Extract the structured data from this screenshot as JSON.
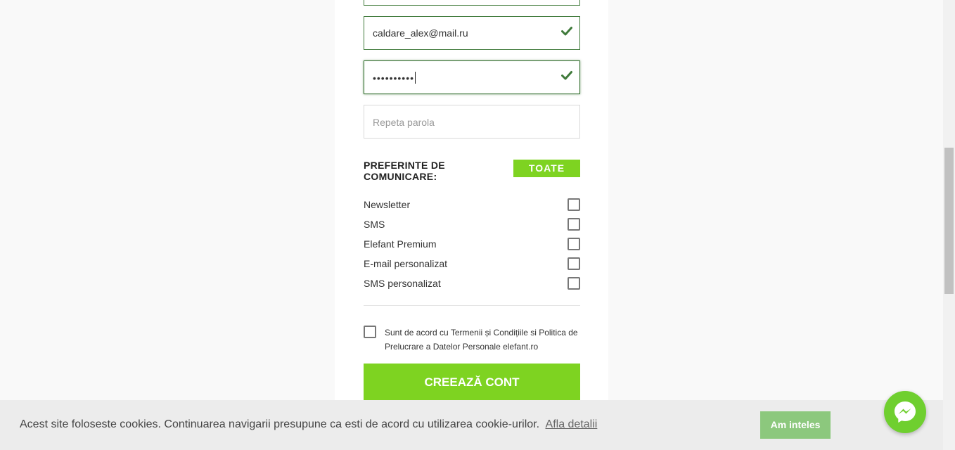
{
  "form": {
    "email_value": "caldare_alex@mail.ru",
    "password_value": "••••••••••",
    "repeat_password_placeholder": "Repeta parola"
  },
  "preferences": {
    "title": "PREFERINTE DE COMUNICARE:",
    "all_button": "TOATE",
    "items": [
      {
        "label": "Newsletter",
        "checked": false
      },
      {
        "label": "SMS",
        "checked": false
      },
      {
        "label": "Elefant Premium",
        "checked": false
      },
      {
        "label": "E-mail personalizat",
        "checked": false
      },
      {
        "label": "SMS personalizat",
        "checked": false
      }
    ]
  },
  "terms": {
    "text": "Sunt de acord cu Termenii și Condițiile si Politica de Prelucrare a Datelor Personale elefant.ro",
    "checked": false
  },
  "create_button": "CREEAZĂ CONT",
  "cookie": {
    "text": "Acest site foloseste cookies. Continuarea navigarii presupune ca esti de acord cu utilizarea cookie-urilor.",
    "link": "Afla detalii",
    "accept": "Am inteles"
  },
  "colors": {
    "accent_green": "#7ed321",
    "valid_green": "#3f7a3a",
    "cookie_button": "#8cc87d",
    "messenger": "#6fcf2f"
  },
  "icons": {
    "valid": "check-icon",
    "messenger": "messenger-icon"
  }
}
